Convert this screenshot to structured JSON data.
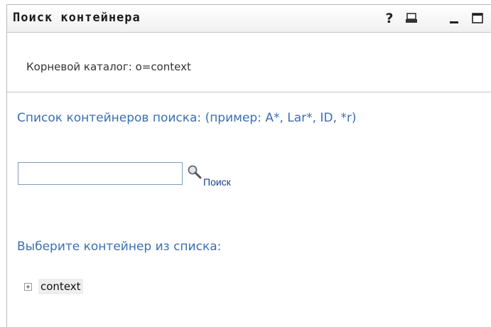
{
  "window": {
    "title": "Поиск контейнера",
    "help_label": "?"
  },
  "root": {
    "text": "Корневой каталог: o=context"
  },
  "search": {
    "label": "Список контейнеров поиска: (пример: A*, Lar*, ID, *r)",
    "value": "",
    "link_label": "Поиск"
  },
  "list": {
    "label": "Выберите контейнер из списка:",
    "items": [
      {
        "label": "context"
      }
    ]
  },
  "colors": {
    "label_blue": "#3b6fb1",
    "link_blue": "#1b3f8f"
  },
  "icons": [
    "help-icon",
    "print-icon",
    "minimize-icon",
    "maximize-icon",
    "magnifier-icon",
    "expand-plus-icon"
  ]
}
